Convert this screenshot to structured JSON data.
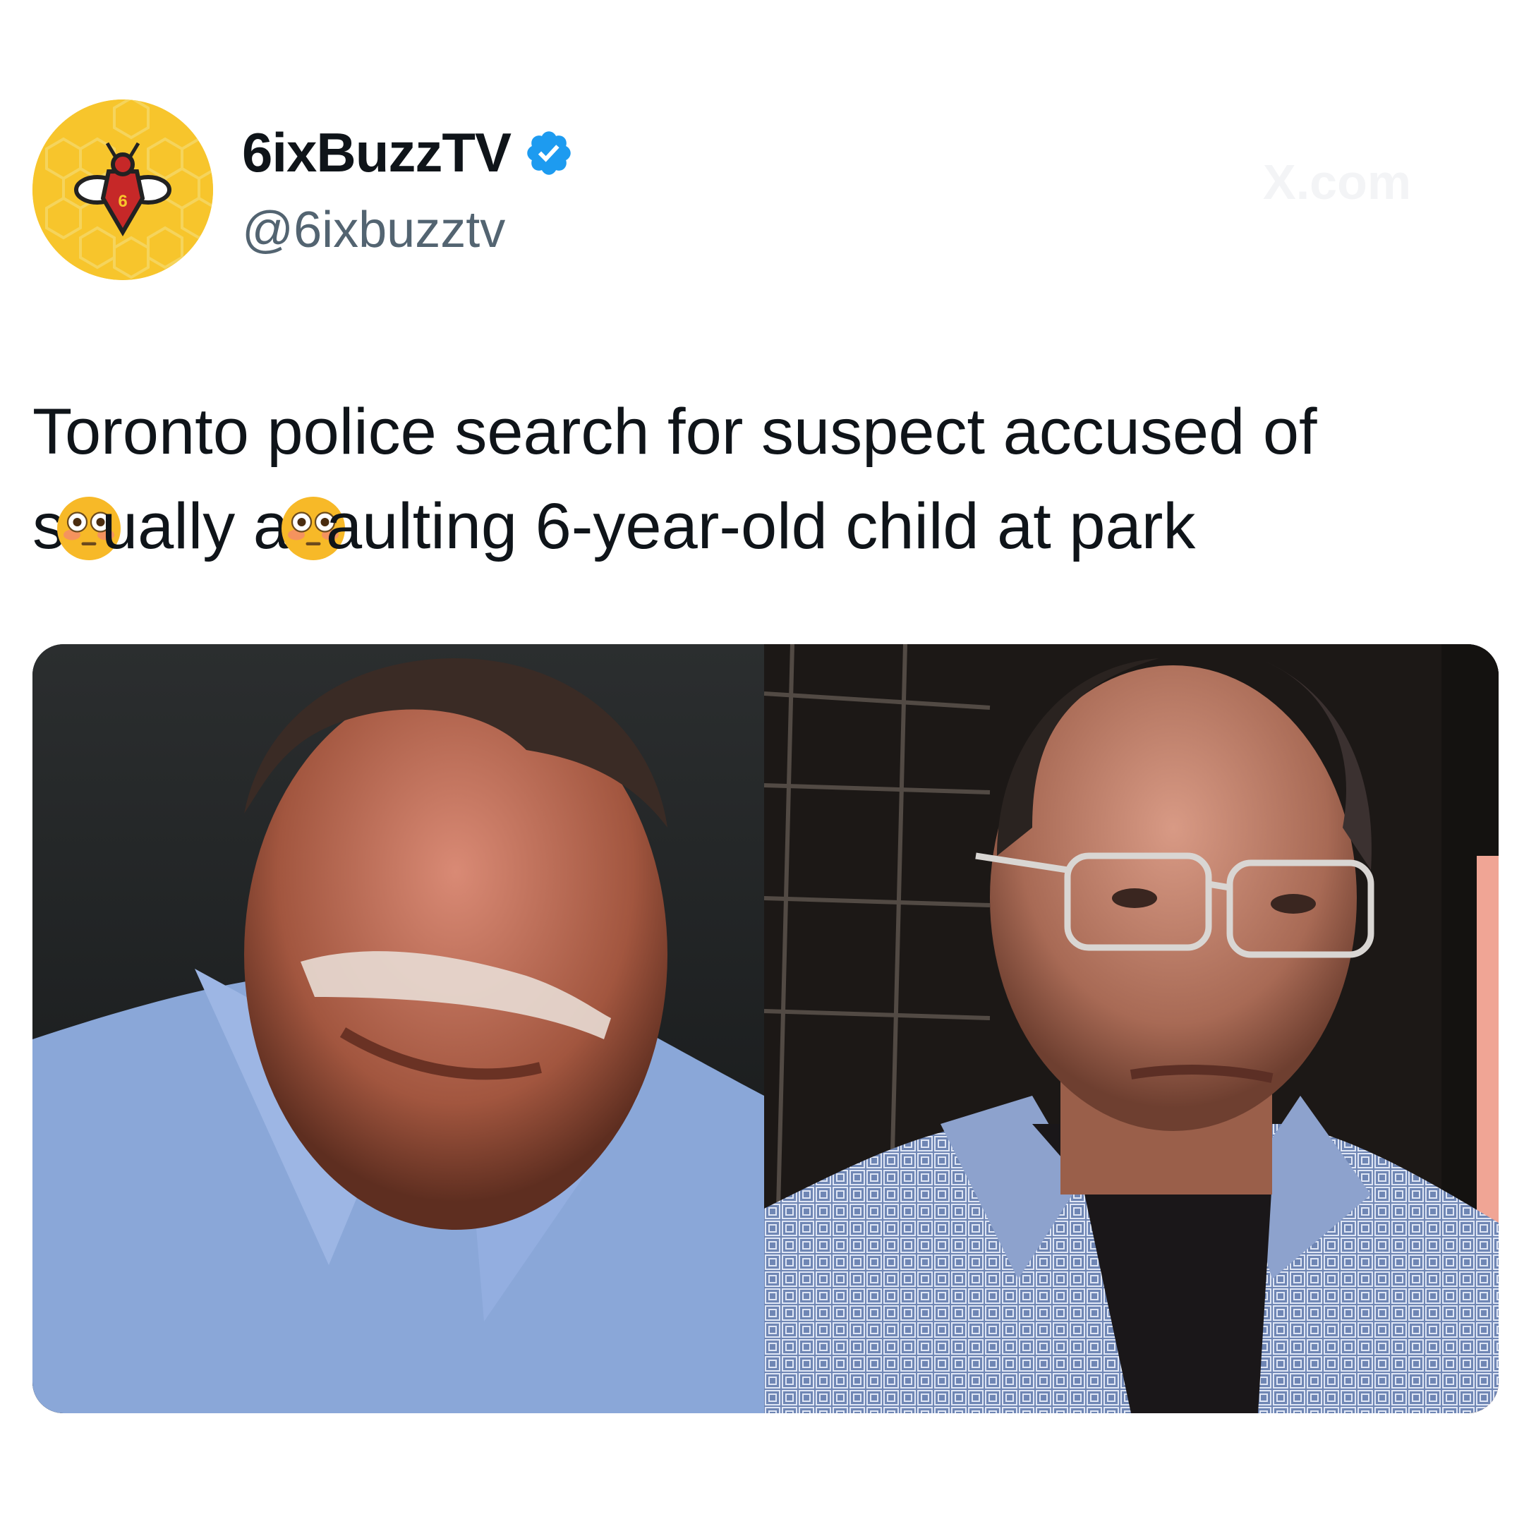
{
  "account": {
    "display_name": "6ixBuzzTV",
    "handle": "@6ixbuzztv",
    "verified": true,
    "avatar_icon": "bee-logo-icon",
    "brand_color": "#f7c52c",
    "verified_color": "#1d9bf0"
  },
  "watermark": "X.com",
  "tweet": {
    "line1": "Toronto police search for suspect accused of",
    "line2_a": "s",
    "line2_b": "ually a",
    "line2_c": "aulting 6-year-old child at park",
    "emoji_icon": "flushed-face-emoji"
  },
  "media": {
    "images": [
      {
        "icon": "photo-suspect-looking-down"
      },
      {
        "icon": "photo-suspect-portrait"
      }
    ]
  }
}
